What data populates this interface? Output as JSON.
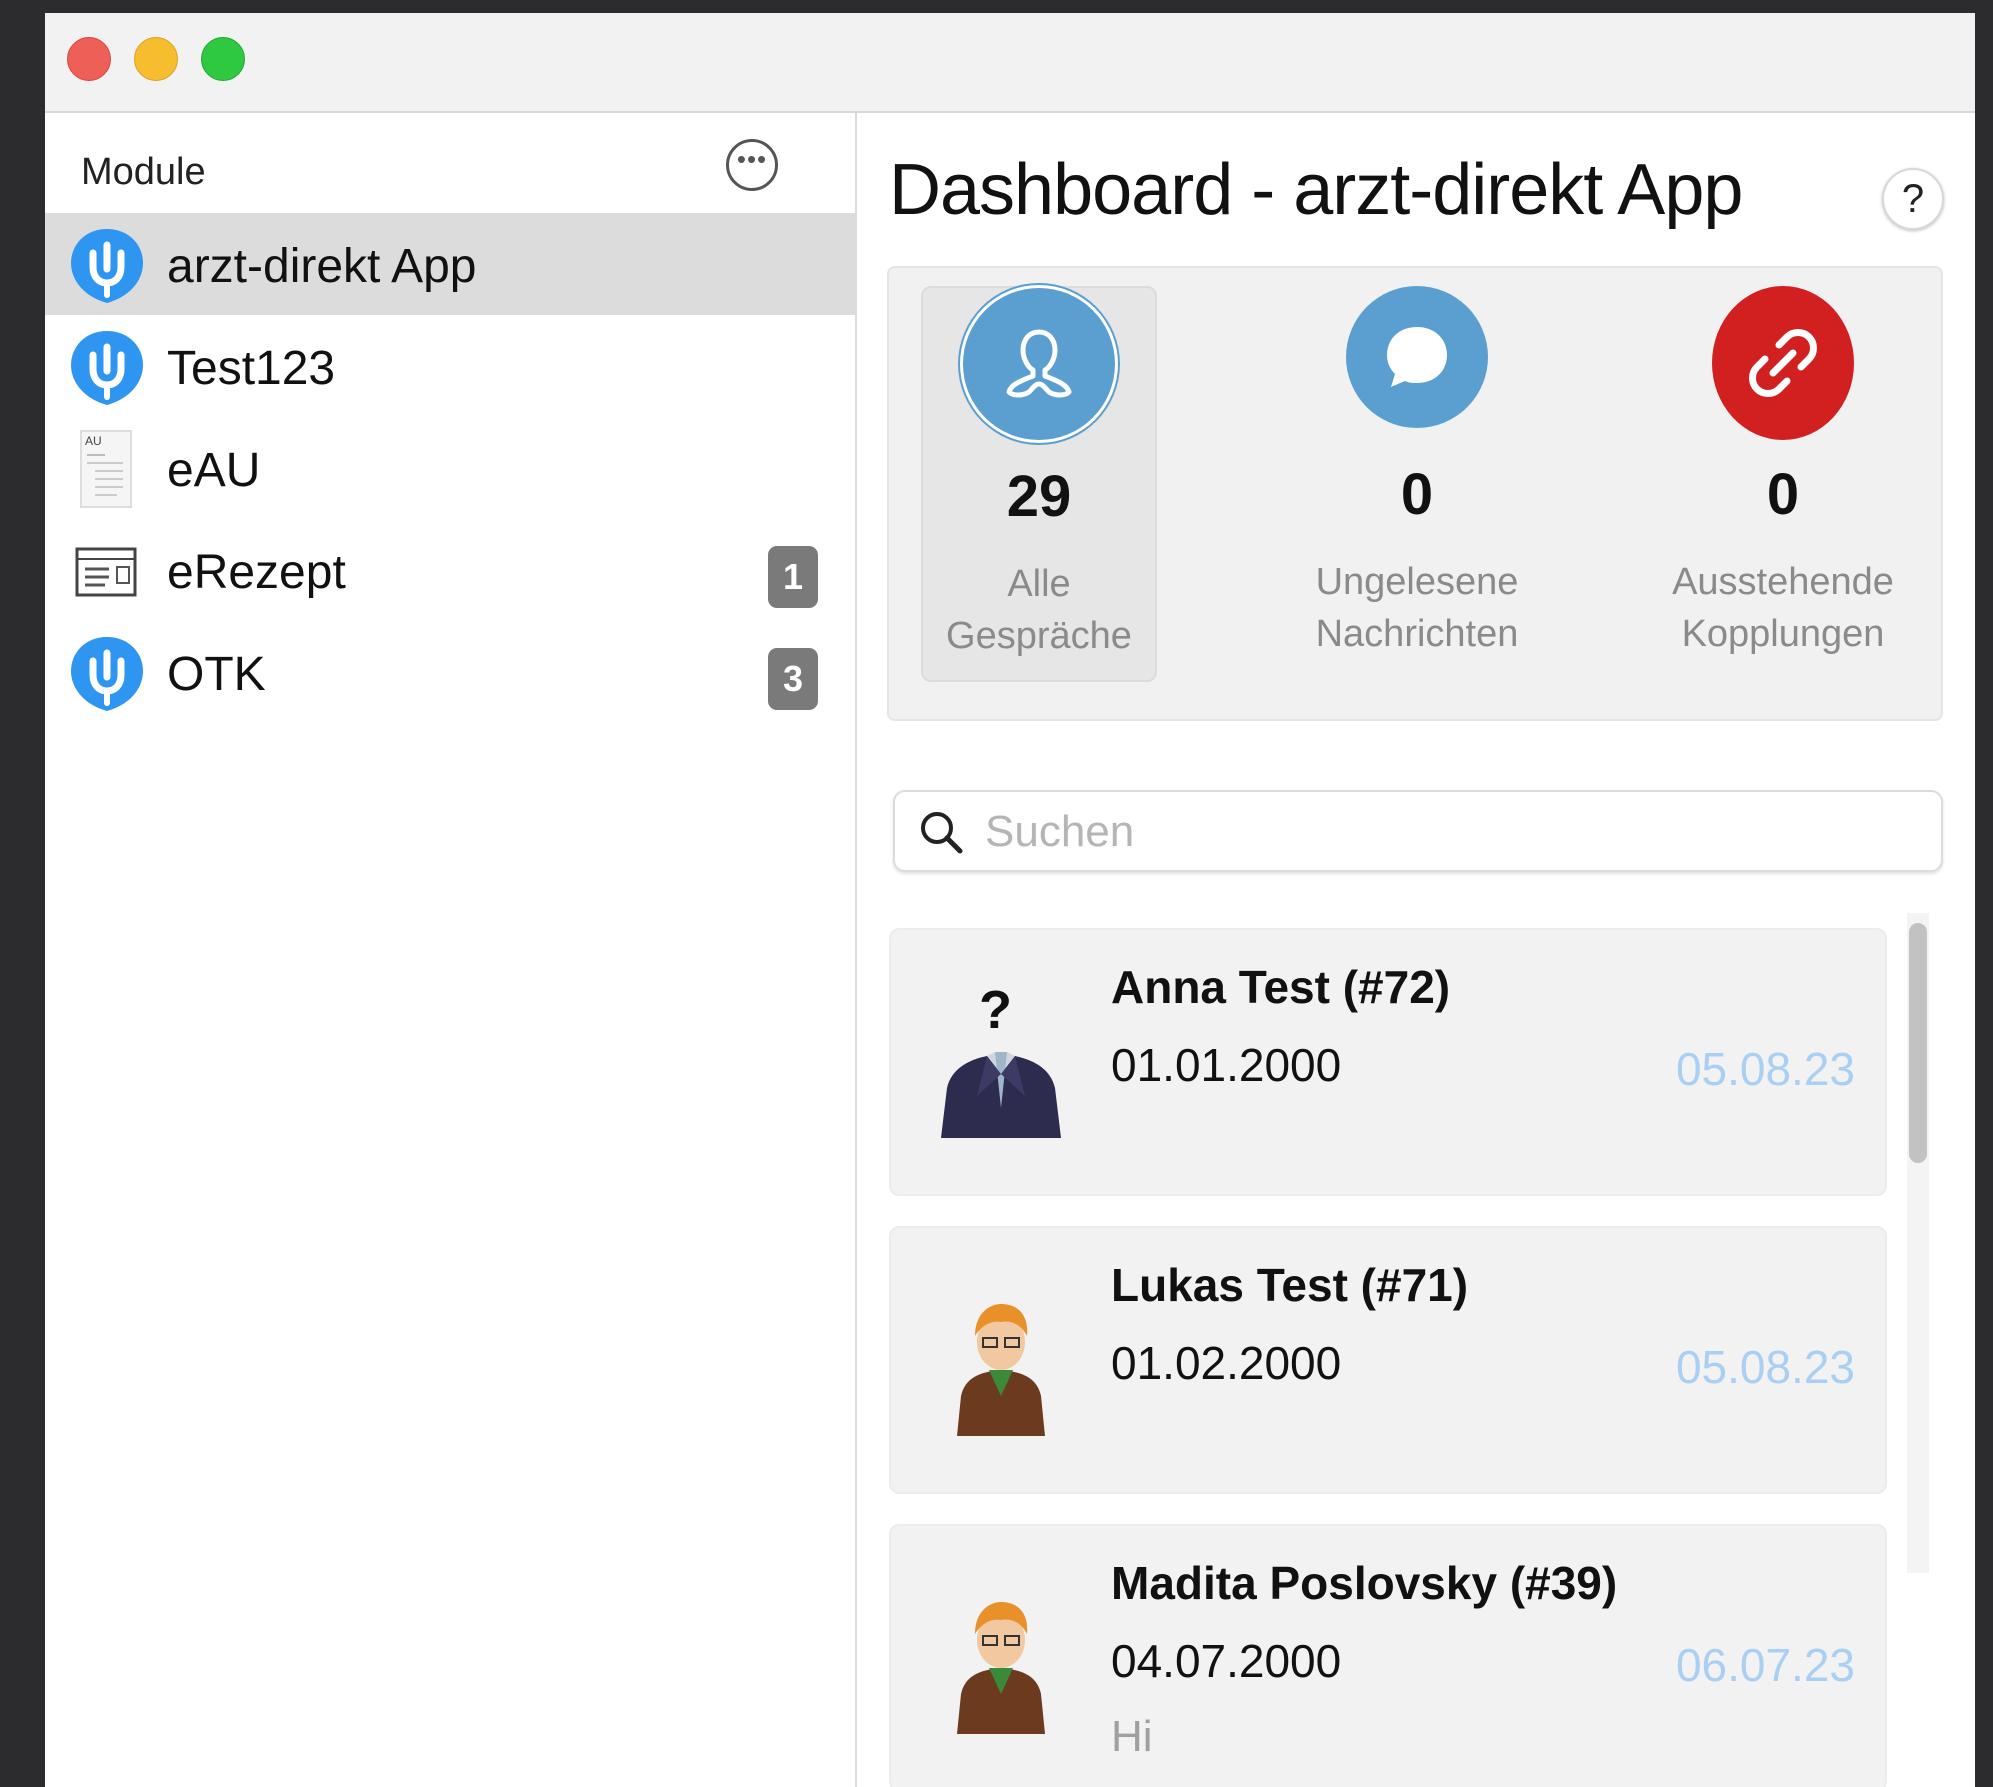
{
  "colors": {
    "accent_blue": "#2e96f0",
    "stat_blue": "#5b9fd1",
    "stat_red": "#d21f1f",
    "date_blue": "#a9cff3",
    "badge_gray": "#7a7a7a"
  },
  "sidebar": {
    "title": "Module",
    "more_icon": "ellipsis-circle-icon",
    "items": [
      {
        "label": "arzt-direkt App",
        "icon": "arzt-direkt-logo-icon",
        "selected": true,
        "badge": ""
      },
      {
        "label": "Test123",
        "icon": "arzt-direkt-logo-icon",
        "selected": false,
        "badge": ""
      },
      {
        "label": "eAU",
        "icon": "au-document-icon",
        "selected": false,
        "badge": "",
        "icon_text": "AU"
      },
      {
        "label": "eRezept",
        "icon": "prescription-icon",
        "selected": false,
        "badge": "1"
      },
      {
        "label": "OTK",
        "icon": "arzt-direkt-logo-icon",
        "selected": false,
        "badge": "3"
      }
    ]
  },
  "main": {
    "title": "Dashboard - arzt-direkt App",
    "help_label": "?",
    "stats": [
      {
        "value": "29",
        "label_line1": "Alle",
        "label_line2": "Gespräche",
        "icon": "person-icon"
      },
      {
        "value": "0",
        "label_line1": "Ungelesene",
        "label_line2": "Nachrichten",
        "icon": "chat-bubble-icon"
      },
      {
        "value": "0",
        "label_line1": "Ausstehende",
        "label_line2": "Kopplungen",
        "icon": "link-icon"
      }
    ],
    "search": {
      "placeholder": "Suchen",
      "value": ""
    },
    "conversations": [
      {
        "name": "Anna Test (#72)",
        "dob": "01.01.2000",
        "date": "05.08.23",
        "preview": "",
        "avatar": "unknown-person-avatar"
      },
      {
        "name": "Lukas Test (#71)",
        "dob": "01.02.2000",
        "date": "05.08.23",
        "preview": "",
        "avatar": "person-avatar"
      },
      {
        "name": "Madita Poslovsky (#39)",
        "dob": "04.07.2000",
        "date": "06.07.23",
        "preview": "Hi",
        "avatar": "person-avatar"
      }
    ]
  }
}
